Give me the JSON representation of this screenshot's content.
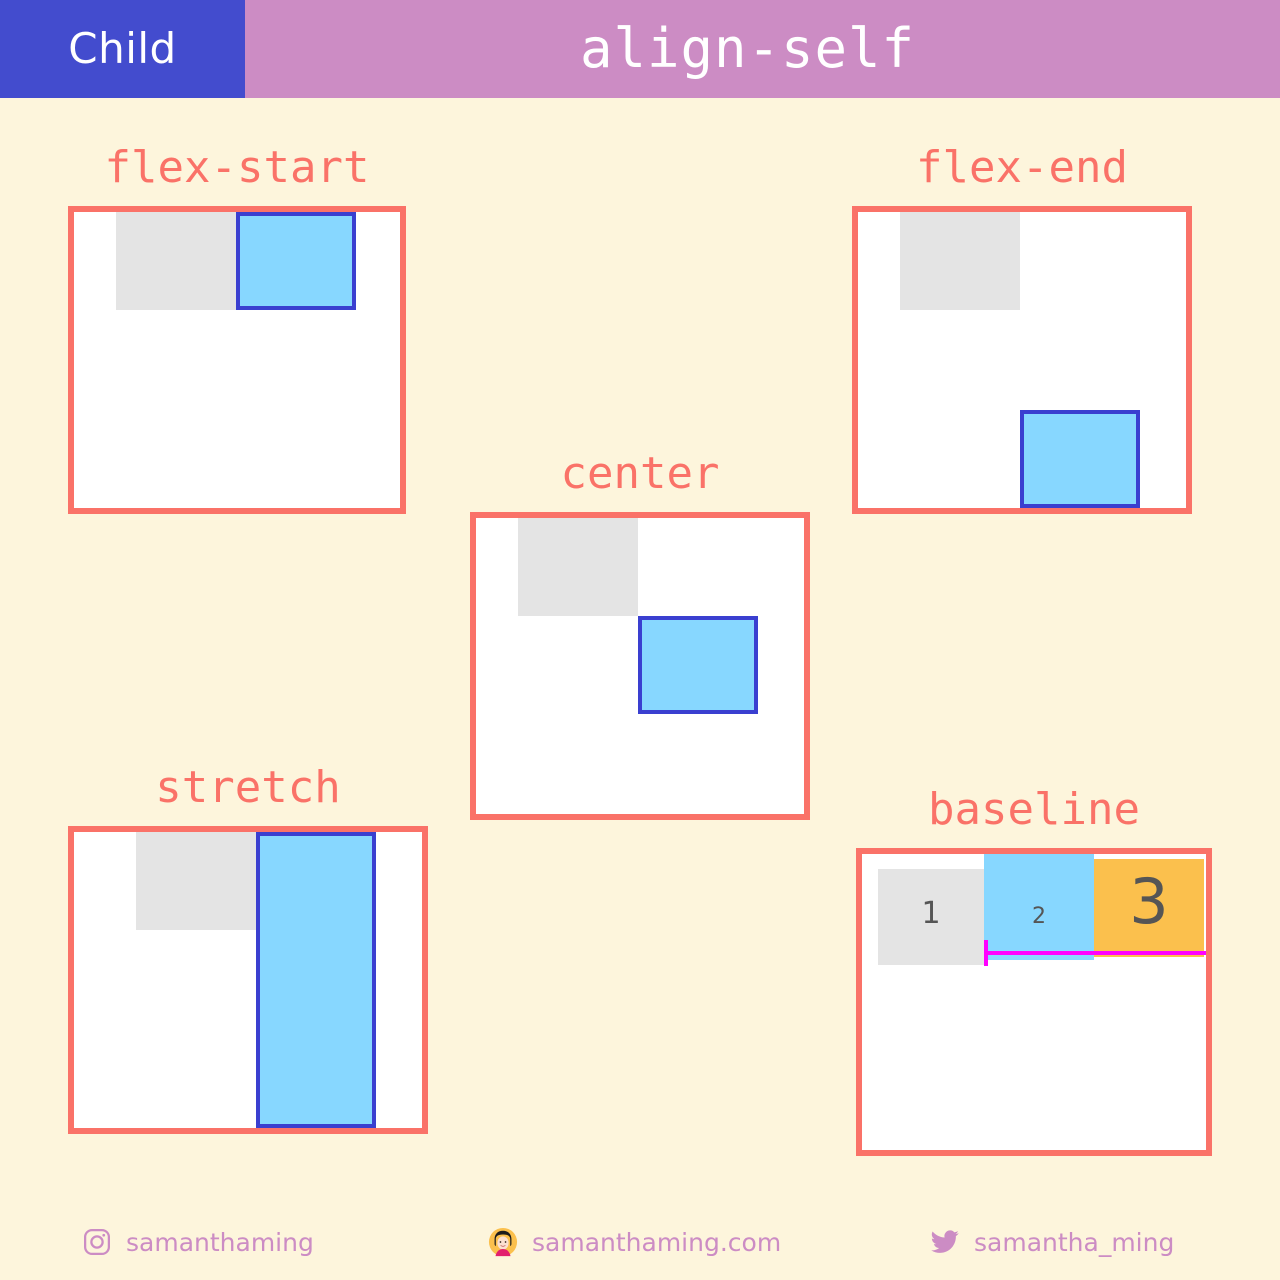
{
  "header": {
    "tab_label": "Child",
    "title": "align-self",
    "tab_bg": "#434cce",
    "bar_bg": "#cc8cc4"
  },
  "theme": {
    "background": "#fdf5dc",
    "box_border": "#fa7268",
    "label_color": "#fa7268",
    "ghost_fill": "#e4e4e4",
    "highlight_fill": "#87d7ff",
    "highlight_border": "#3a3fd0",
    "orange_fill": "#fbc04d",
    "baseline_marker": "#ff00ff",
    "footer_color": "#cc8cc4",
    "number_color": "#555555"
  },
  "demos": [
    {
      "id": "flex-start",
      "label": "flex-start"
    },
    {
      "id": "flex-end",
      "label": "flex-end"
    },
    {
      "id": "center",
      "label": "center"
    },
    {
      "id": "stretch",
      "label": "stretch"
    },
    {
      "id": "baseline",
      "label": "baseline"
    }
  ],
  "baseline_items": [
    {
      "number": "1"
    },
    {
      "number": "2"
    },
    {
      "number": "3"
    }
  ],
  "footer": {
    "instagram": {
      "icon": "instagram-icon",
      "handle": "samanthaming"
    },
    "website": {
      "icon": "avatar-icon",
      "handle": "samanthaming.com",
      "emoji": "👩"
    },
    "twitter": {
      "icon": "twitter-icon",
      "handle": "samantha_ming"
    }
  }
}
